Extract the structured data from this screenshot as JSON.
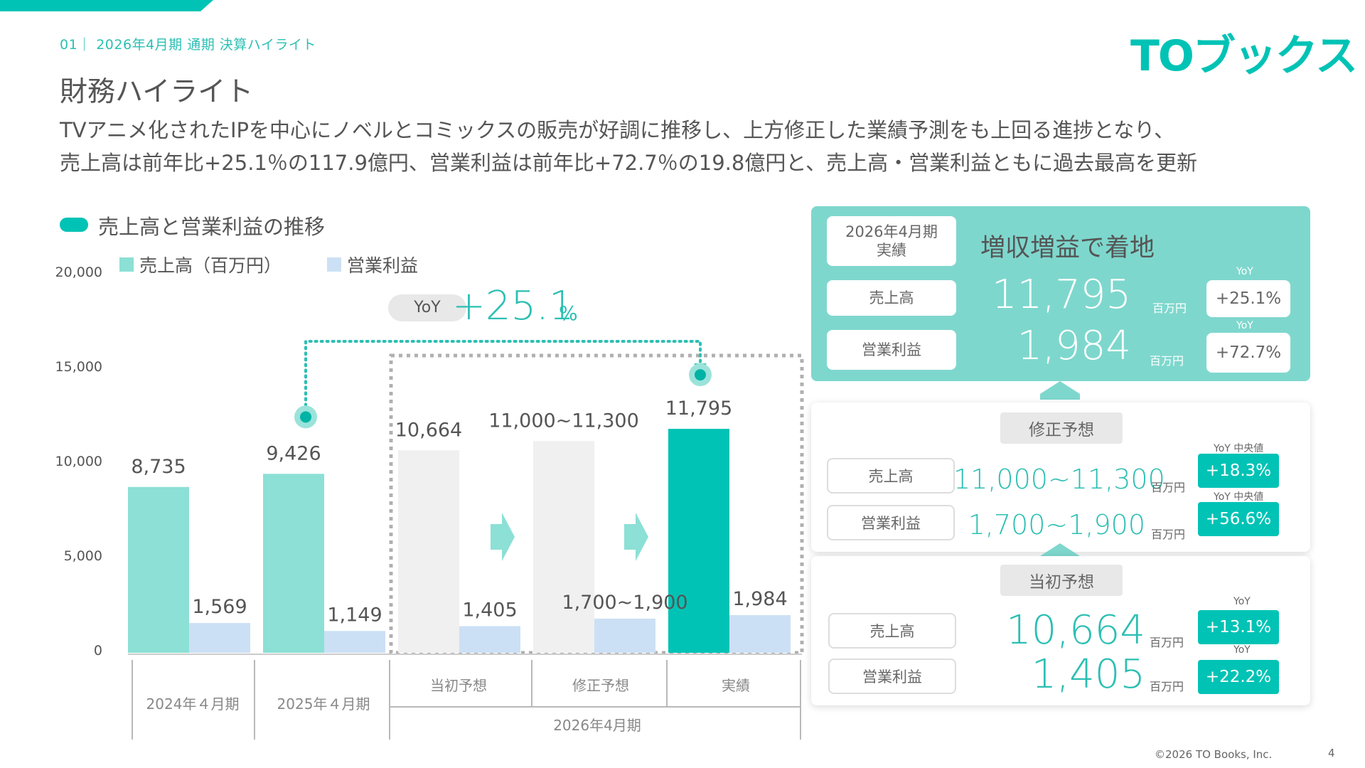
{
  "header": {
    "breadcrumb": "01｜ 2026年4月期 通期 決算ハイライト",
    "logo_text": "TOブックス",
    "page_title": "財務ハイライト",
    "lead_line1": "TVアニメ化されたIPを中心にノベルとコミックスの販売が好調に推移し、上方修正した業績予測をも上回る進捗となり、",
    "lead_line2": "売上高は前年比+25.1％の117.9億円、営業利益は前年比+72.7％の19.8億円と、売上高・営業利益ともに過去最高を更新"
  },
  "section": {
    "heading": "売上高と営業利益の推移",
    "legend_revenue": "売上高（百万円）",
    "legend_profit": "営業利益"
  },
  "chart_data": {
    "type": "bar",
    "categories": [
      "2024年４月期",
      "2025年４月期",
      "当初予想",
      "修正予想",
      "実績"
    ],
    "group_label": "2026年4月期",
    "ylim": [
      0,
      20000
    ],
    "yticks": [
      "20,000",
      "15,000",
      "10,000",
      "5,000",
      "0"
    ],
    "series": [
      {
        "name": "売上高（百万円）",
        "values": [
          8735,
          9426,
          10664,
          11150,
          11795
        ],
        "labels": [
          "8,735",
          "9,426",
          "10,664",
          "11,000~11,300",
          "11,795"
        ]
      },
      {
        "name": "営業利益",
        "values": [
          1569,
          1149,
          1405,
          1800,
          1984
        ],
        "labels": [
          "1,569",
          "1,149",
          "1,405",
          "1,700~1,900",
          "1,984"
        ]
      }
    ],
    "yoy_label": "YoY",
    "yoy_value": "+25.1",
    "yoy_unit": "%",
    "colors": {
      "revenue_past": "#8ce0d5",
      "revenue_forecast": "#f0f0f0",
      "revenue_actual": "#00c3b5",
      "profit": "#cce0f5"
    }
  },
  "panel_result": {
    "period": "2026年4月期",
    "period_sub": "実績",
    "headline": "増収増益で着地",
    "rev_label": "売上高",
    "rev_value": "11,795",
    "rev_unit": "百万円",
    "rev_yoy_caption": "YoY",
    "rev_yoy": "+25.1%",
    "op_label": "営業利益",
    "op_value": "1,984",
    "op_unit": "百万円",
    "op_yoy_caption": "YoY",
    "op_yoy": "+72.7%"
  },
  "panel_revised": {
    "tag": "修正予想",
    "rev_label": "売上高",
    "rev_value": "11,000~11,300",
    "rev_unit": "百万円",
    "rev_yoy_caption": "YoY 中央値",
    "rev_yoy": "+18.3%",
    "op_label": "営業利益",
    "op_value": "1,700~1,900",
    "op_unit": "百万円",
    "op_yoy_caption": "YoY 中央値",
    "op_yoy": "+56.6%"
  },
  "panel_initial": {
    "tag": "当初予想",
    "rev_label": "売上高",
    "rev_value": "10,664",
    "rev_unit": "百万円",
    "rev_yoy_caption": "YoY",
    "rev_yoy": "+13.1%",
    "op_label": "営業利益",
    "op_value": "1,405",
    "op_unit": "百万円",
    "op_yoy_caption": "YoY",
    "op_yoy": "+22.2%"
  },
  "footer": {
    "copyright": "©2026  TO Books, Inc.",
    "page_number": "4"
  }
}
